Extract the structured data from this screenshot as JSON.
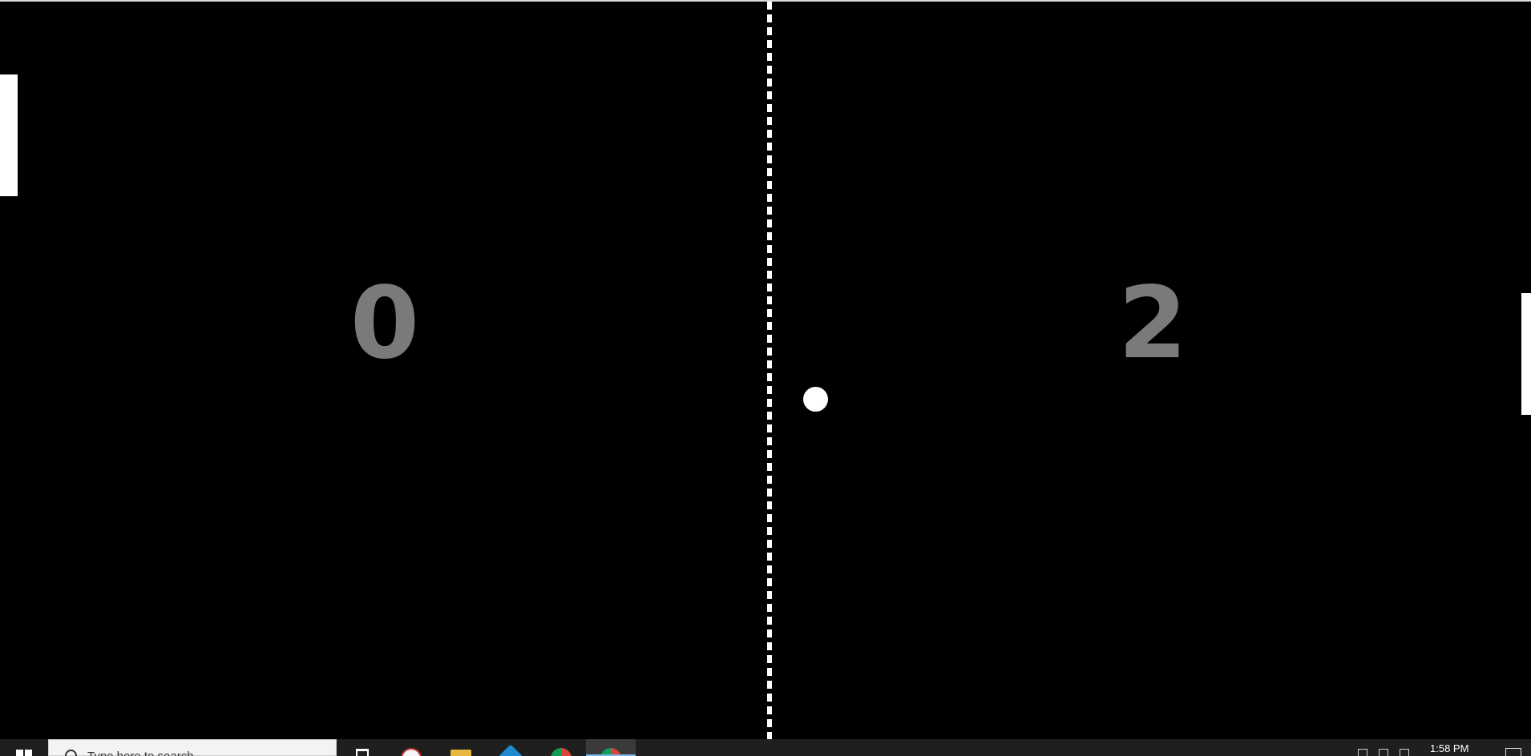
{
  "game": {
    "score_left": "0",
    "score_right": "2"
  },
  "taskbar": {
    "search_placeholder": "Type here to search",
    "clock_time": "1:58 PM",
    "apps": [
      "paint-icon",
      "file-explorer-icon",
      "vscode-icon",
      "chrome-icon",
      "chrome-icon"
    ]
  },
  "colors": {
    "background": "#000000",
    "foreground": "#ffffff",
    "score": "#7a7a7a",
    "taskbar": "#1f1f1f"
  }
}
